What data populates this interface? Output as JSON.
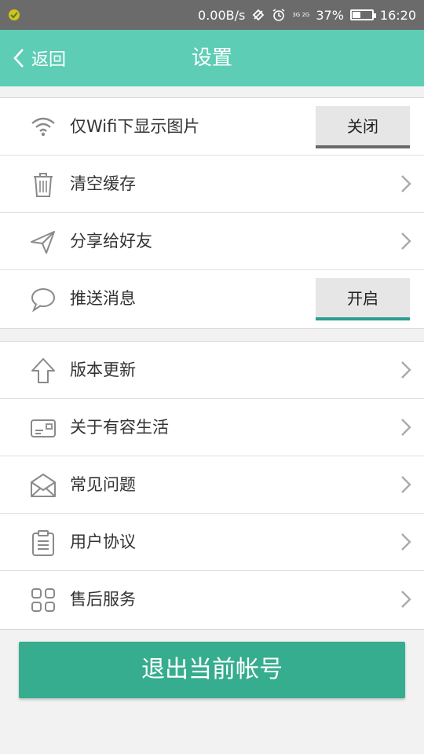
{
  "status_bar": {
    "network_speed": "0.00B/s",
    "network_type": "3G 2G",
    "battery": "37%",
    "time": "16:20",
    "battery_level": 0.37
  },
  "header": {
    "back_label": "返回",
    "title": "设置"
  },
  "group1": [
    {
      "label": "仅Wifi下显示图片",
      "icon": "wifi-icon",
      "control": "toggle",
      "toggle_label": "关闭"
    },
    {
      "label": "清空缓存",
      "icon": "trash-icon",
      "control": "chevron"
    },
    {
      "label": "分享给好友",
      "icon": "share-icon",
      "control": "chevron"
    },
    {
      "label": "推送消息",
      "icon": "chat-bubble-icon",
      "control": "toggle",
      "toggle_label": "开启"
    }
  ],
  "group2": [
    {
      "label": "版本更新",
      "icon": "arrow-up-icon"
    },
    {
      "label": "关于有容生活",
      "icon": "card-icon"
    },
    {
      "label": "常见问题",
      "icon": "envelope-icon"
    },
    {
      "label": "用户协议",
      "icon": "clipboard-icon"
    },
    {
      "label": "售后服务",
      "icon": "grid-icon"
    }
  ],
  "logout_label": "退出当前帐号",
  "colors": {
    "header": "#5dcdb5",
    "logout": "#36ad8e",
    "toggle_on_indicator": "#2a9d8f",
    "toggle_off_indicator": "#6a6a6a"
  }
}
